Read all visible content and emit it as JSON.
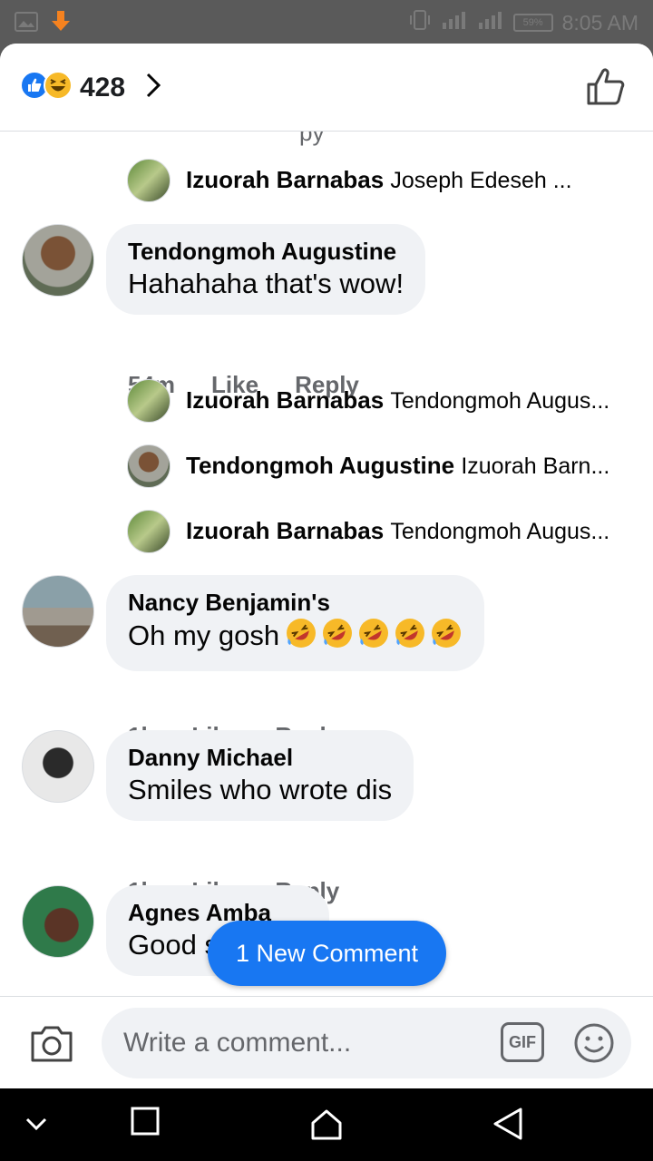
{
  "status_bar": {
    "time": "8:05 AM",
    "battery": "59%",
    "icons": [
      "image-icon",
      "download-arrow-icon",
      "vibrate-icon",
      "signal-icon",
      "signal-icon",
      "battery-icon"
    ]
  },
  "header": {
    "reactions": [
      "like-reaction-icon",
      "haha-reaction-icon"
    ],
    "reaction_count": "428",
    "colors": {
      "like": "#1877f2",
      "haha": "#f7b928"
    }
  },
  "comments": {
    "top_reply": {
      "name": "Izuorah Barnabas",
      "text": "Joseph Edeseh ..."
    },
    "thread1": {
      "author": "Tendongmoh Augustine",
      "text": "Hahahaha that's wow!",
      "time": "54m",
      "like_label": "Like",
      "reply_label": "Reply",
      "replies": [
        {
          "name": "Izuorah Barnabas",
          "text": "Tendongmoh Augus..."
        },
        {
          "name": "Tendongmoh Augustine",
          "text": "Izuorah Barn..."
        },
        {
          "name": "Izuorah Barnabas",
          "text": "Tendongmoh Augus..."
        }
      ]
    },
    "thread2": {
      "author": "Nancy Benjamin's",
      "text": "Oh my gosh",
      "emoji_count": 5,
      "time": "1h",
      "like_label": "Like",
      "reply_label": "Reply"
    },
    "thread3": {
      "author": "Danny Michael",
      "text": "Smiles who wrote dis",
      "time": "1h",
      "like_label": "Like",
      "reply_label": "Reply"
    },
    "thread4": {
      "author": "Agnes Amba",
      "text": "Good s"
    }
  },
  "new_comment_button": "1 New Comment",
  "composer": {
    "placeholder": "Write a comment...",
    "gif_label": "GIF"
  },
  "accent_color": "#1877f2"
}
